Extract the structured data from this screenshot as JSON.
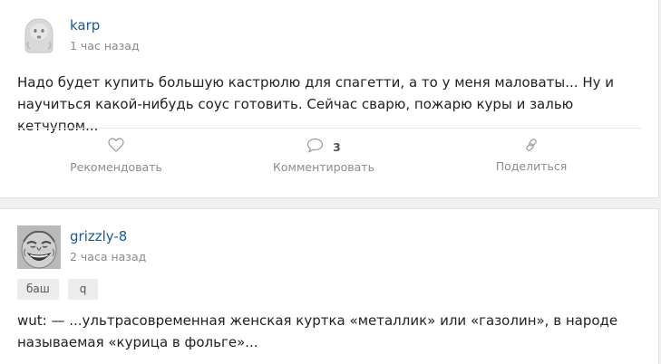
{
  "posts": [
    {
      "author": "karp",
      "time": "1 час назад",
      "avatar_icon": "ghost-avatar-icon",
      "text": "Надо будет купить большую кастрюлю для спагетти, а то у меня маловаты... Ну и научиться какой-нибудь соус готовить. Сейчас сварю, пожарю куры и залью кетчупом...",
      "actions": {
        "recommend_label": "Рекомендовать",
        "comment_label": "Комментировать",
        "comment_count": "3",
        "share_label": "Поделиться"
      }
    },
    {
      "author": "grizzly-8",
      "time": "2 часа назад",
      "avatar_icon": "laughing-face-avatar-icon",
      "tags": [
        "баш",
        "q"
      ],
      "text": "wut: — ...ультрасовременная женская куртка «металлик» или «газолин», в народе называемая «курица в фольге»..."
    }
  ],
  "colors": {
    "author_link": "#1a5a96",
    "muted": "#8a8a8a",
    "background": "#f0f0f0",
    "card": "#ffffff",
    "tag_bg": "#ececec"
  }
}
